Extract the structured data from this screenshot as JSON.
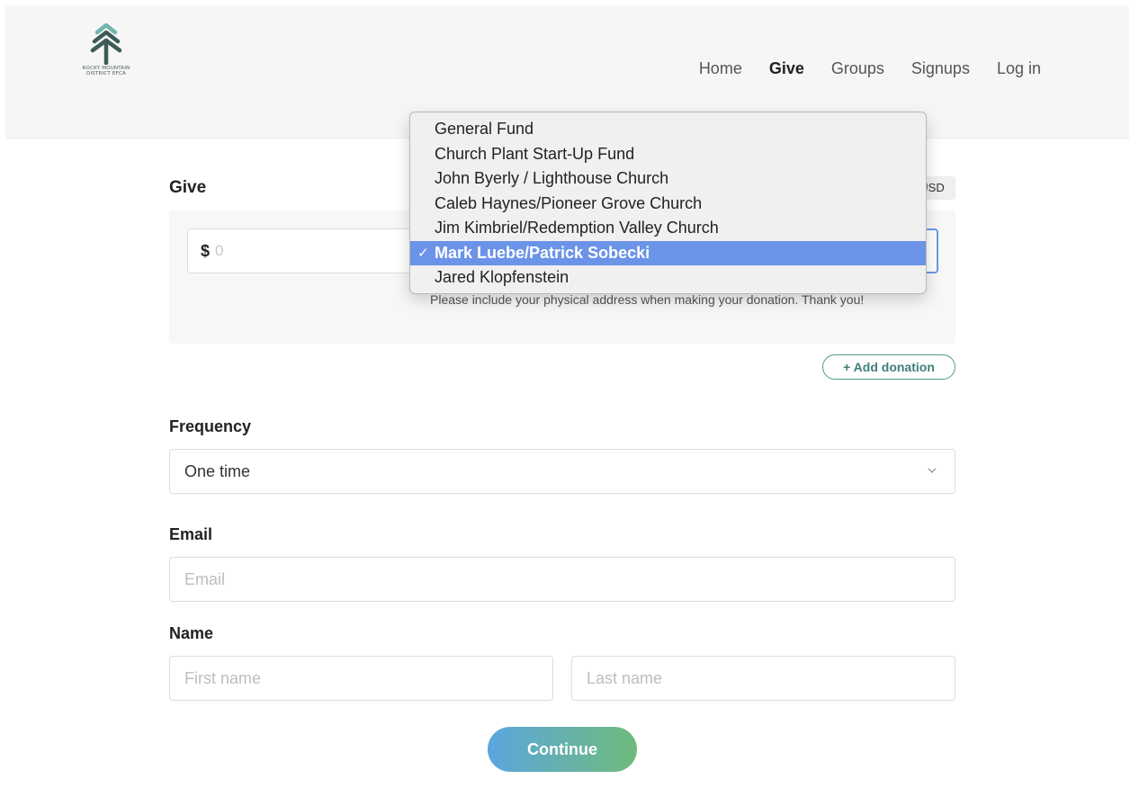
{
  "header": {
    "logo_line1": "ROCKY MOUNTAIN",
    "logo_line2": "DISTRICT EFCA",
    "nav": [
      "Home",
      "Give",
      "Groups",
      "Signups",
      "Log in"
    ],
    "active_nav": "Give"
  },
  "give": {
    "title": "Give",
    "currency": "USD",
    "amount_symbol": "$",
    "amount_placeholder": "0",
    "note": "Please include your physical address when making your donation. Thank you!",
    "add_donation": "+ Add donation"
  },
  "fund_dropdown": {
    "options": [
      "General Fund",
      "Church Plant Start-Up Fund",
      "John Byerly / Lighthouse Church",
      "Caleb Haynes/Pioneer Grove Church",
      "Jim Kimbriel/Redemption Valley Church",
      "Mark Luebe/Patrick Sobecki",
      "Jared Klopfenstein"
    ],
    "selected": "Mark Luebe/Patrick Sobecki",
    "check": "✓"
  },
  "frequency": {
    "label": "Frequency",
    "value": "One time"
  },
  "email": {
    "label": "Email",
    "placeholder": "Email"
  },
  "name": {
    "label": "Name",
    "first_placeholder": "First name",
    "last_placeholder": "Last name"
  },
  "continue_label": "Continue",
  "colors": {
    "accent": "#4c9b8f",
    "select_highlight": "#6b93e8",
    "gradient_start": "#5ba6df",
    "gradient_end": "#6fbb7c"
  }
}
